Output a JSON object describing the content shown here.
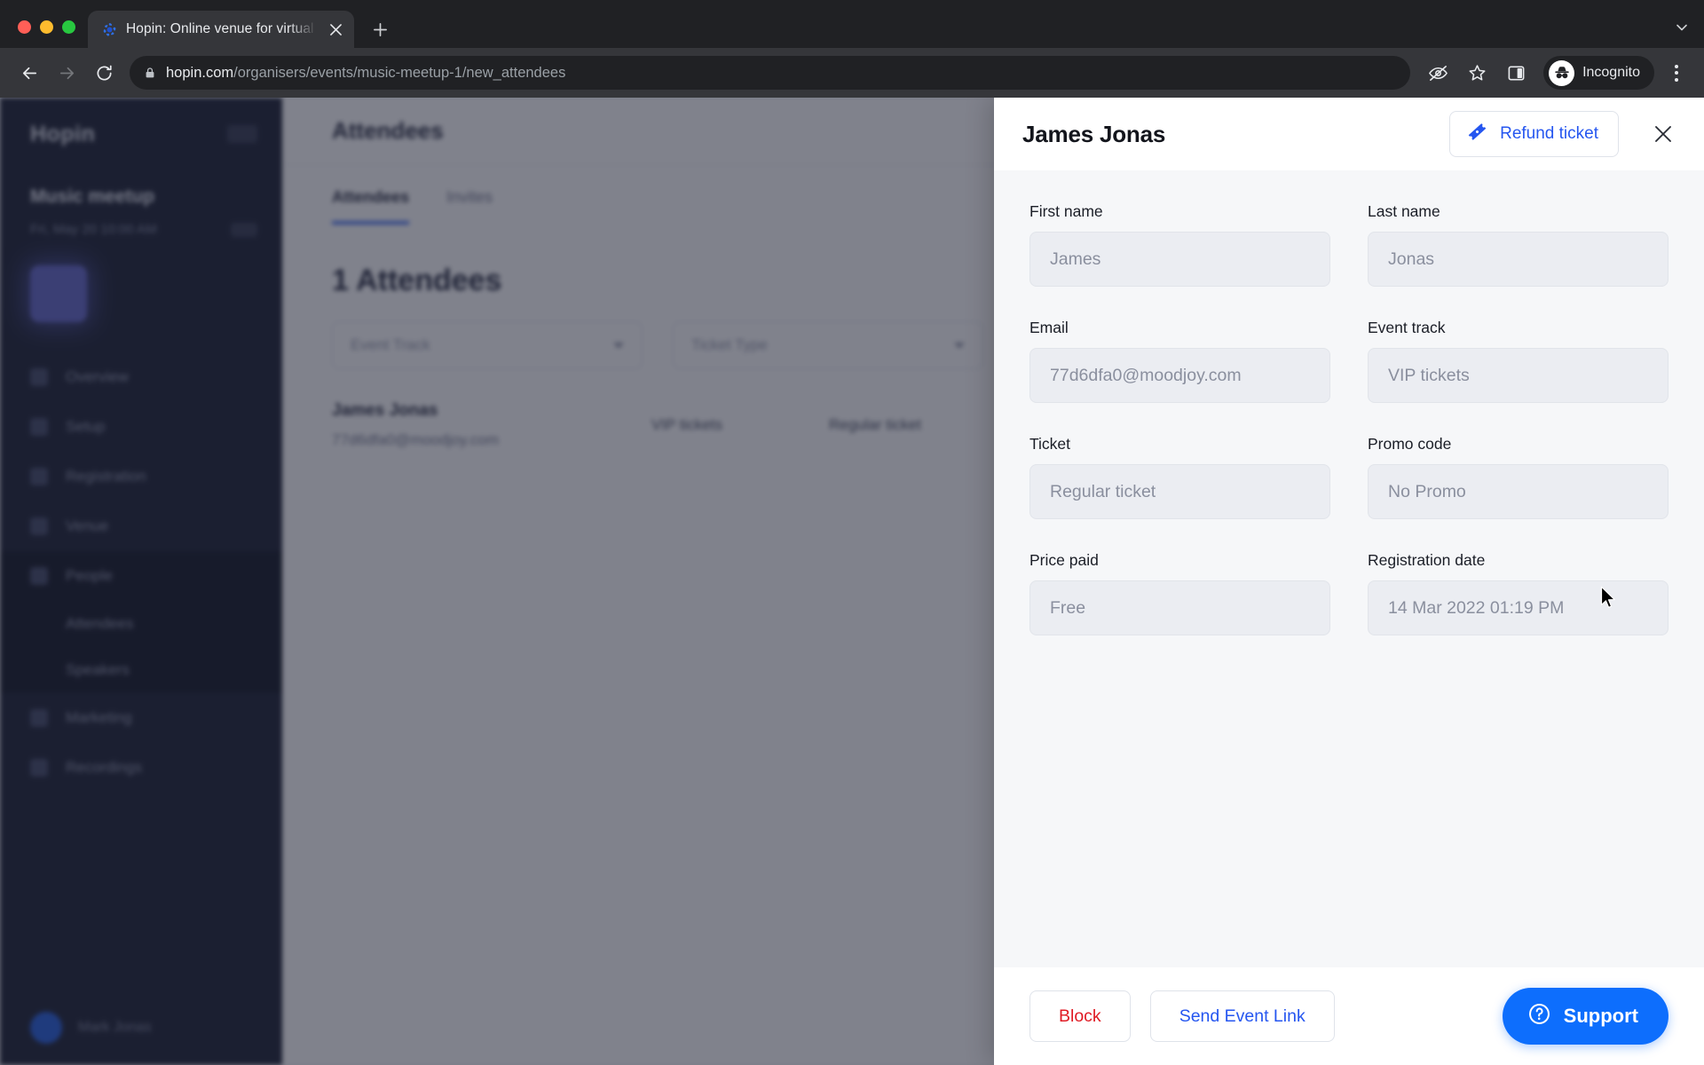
{
  "browser": {
    "tab": {
      "title": "Hopin: Online venue for virtual",
      "favicon_icon": "hopin-logo-icon",
      "close_icon": "close-icon"
    },
    "new_tab_label": "+",
    "tabstrip_chevron_icon": "chevron-down-icon",
    "toolbar": {
      "back_icon": "back-arrow-icon",
      "forward_icon": "forward-arrow-icon",
      "reload_icon": "reload-icon",
      "lock_icon": "lock-icon",
      "url_host": "hopin.com",
      "url_path": "/organisers/events/music-meetup-1/new_attendees",
      "tracking_protection_icon": "eye-slash-icon",
      "bookmark_icon": "star-icon",
      "side_panel_icon": "side-panel-icon",
      "profile_icon": "incognito-icon",
      "profile_label": "Incognito",
      "menu_icon": "kebab-menu-icon"
    }
  },
  "app": {
    "sidebar": {
      "brand": "Hopin",
      "brand_badge": "",
      "event_name": "Music meetup",
      "event_meta": "Fri, May 20 10:00 AM",
      "event_badge": "",
      "items": [
        {
          "label": "Overview",
          "icon": "grid-icon"
        },
        {
          "label": "Setup",
          "icon": "sliders-icon"
        },
        {
          "label": "Registration",
          "icon": "ticket-icon"
        },
        {
          "label": "Venue",
          "icon": "building-icon"
        },
        {
          "label": "People",
          "icon": "people-icon"
        }
      ],
      "sub_items": [
        {
          "label": "Attendees"
        },
        {
          "label": "Speakers"
        }
      ],
      "items_after": [
        {
          "label": "Marketing",
          "icon": "megaphone-icon"
        },
        {
          "label": "Recordings",
          "icon": "video-icon"
        }
      ],
      "user_name": "Mark Jonas"
    },
    "content": {
      "page_title": "Attendees",
      "tabs": [
        {
          "label": "Attendees",
          "active": true
        },
        {
          "label": "Invites",
          "active": false
        }
      ],
      "count_heading": "1 Attendees",
      "filters": [
        {
          "label": "Event Track",
          "caret_icon": "chevron-down-icon"
        },
        {
          "label": "Ticket Type",
          "caret_icon": "chevron-down-icon"
        }
      ],
      "table_row": {
        "name": "James Jonas",
        "email": "77d6dfa0@moodjoy.com",
        "track": "VIP tickets",
        "ticket": "Regular ticket"
      }
    }
  },
  "panel": {
    "title": "James Jonas",
    "refund_label": "Refund ticket",
    "refund_icon": "ticket-icon",
    "close_icon": "close-icon",
    "fields": [
      {
        "label": "First name",
        "value": "James",
        "name": "first-name"
      },
      {
        "label": "Last name",
        "value": "Jonas",
        "name": "last-name"
      },
      {
        "label": "Email",
        "value": "77d6dfa0@moodjoy.com",
        "name": "email"
      },
      {
        "label": "Event track",
        "value": "VIP tickets",
        "name": "event-track"
      },
      {
        "label": "Ticket",
        "value": "Regular ticket",
        "name": "ticket"
      },
      {
        "label": "Promo code",
        "value": "No Promo",
        "name": "promo-code"
      },
      {
        "label": "Price paid",
        "value": "Free",
        "name": "price-paid"
      },
      {
        "label": "Registration date",
        "value": "14 Mar 2022 01:19 PM",
        "name": "registration-date"
      }
    ],
    "footer": {
      "block_label": "Block",
      "send_link_label": "Send Event Link",
      "support_label": "Support",
      "support_icon": "question-circle-icon"
    }
  },
  "colors": {
    "accent_blue": "#2556f0",
    "support_blue": "#0d6efd",
    "danger_red": "#e01b24",
    "panel_bg": "#f6f7f9",
    "field_bg": "#ebedf2",
    "sidebar_bg": "#101528"
  }
}
